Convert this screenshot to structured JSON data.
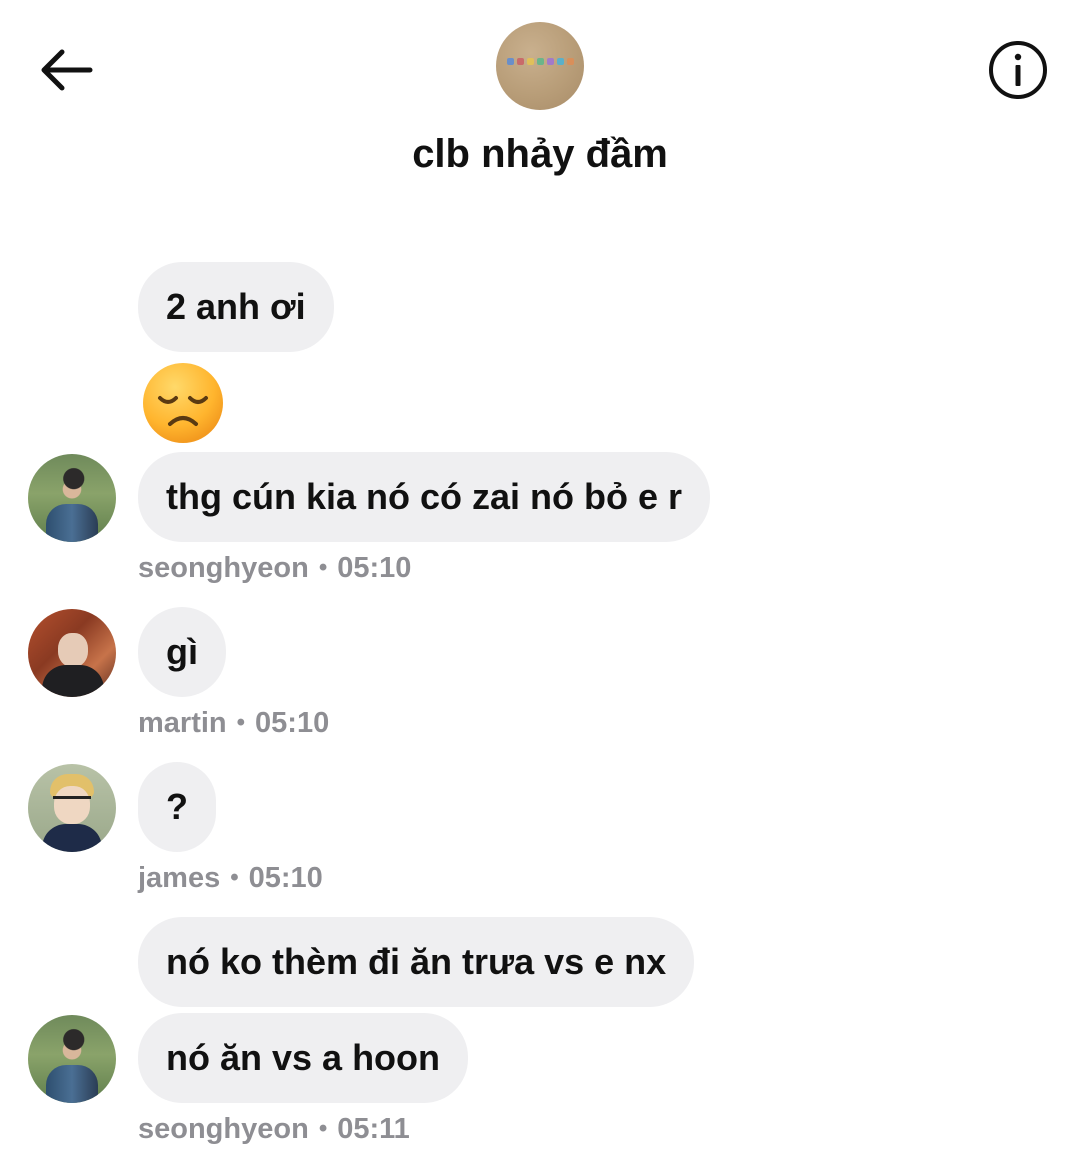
{
  "header": {
    "title": "clb nhảy đầm",
    "back_icon": "arrow-left-icon",
    "info_icon": "info-circle-icon"
  },
  "messages": [
    {
      "text": "2 anh ơi"
    },
    {
      "text": "😞"
    },
    {
      "text": "thg cún kia nó có zai nó bỏ e r"
    },
    {
      "text": "gì"
    },
    {
      "text": "?"
    },
    {
      "text": "nó ko thèm đi ăn trưa vs e nx"
    },
    {
      "text": "nó ăn vs a hoon"
    }
  ],
  "meta": [
    {
      "sender": "seonghyeon",
      "time": "05:10"
    },
    {
      "sender": "martin",
      "time": "05:10"
    },
    {
      "sender": "james",
      "time": "05:10"
    },
    {
      "sender": "seonghyeon",
      "time": "05:11"
    }
  ],
  "colors": {
    "bubble": "#efeff1",
    "meta_text": "#8e8e93",
    "text": "#111111",
    "background": "#ffffff"
  }
}
